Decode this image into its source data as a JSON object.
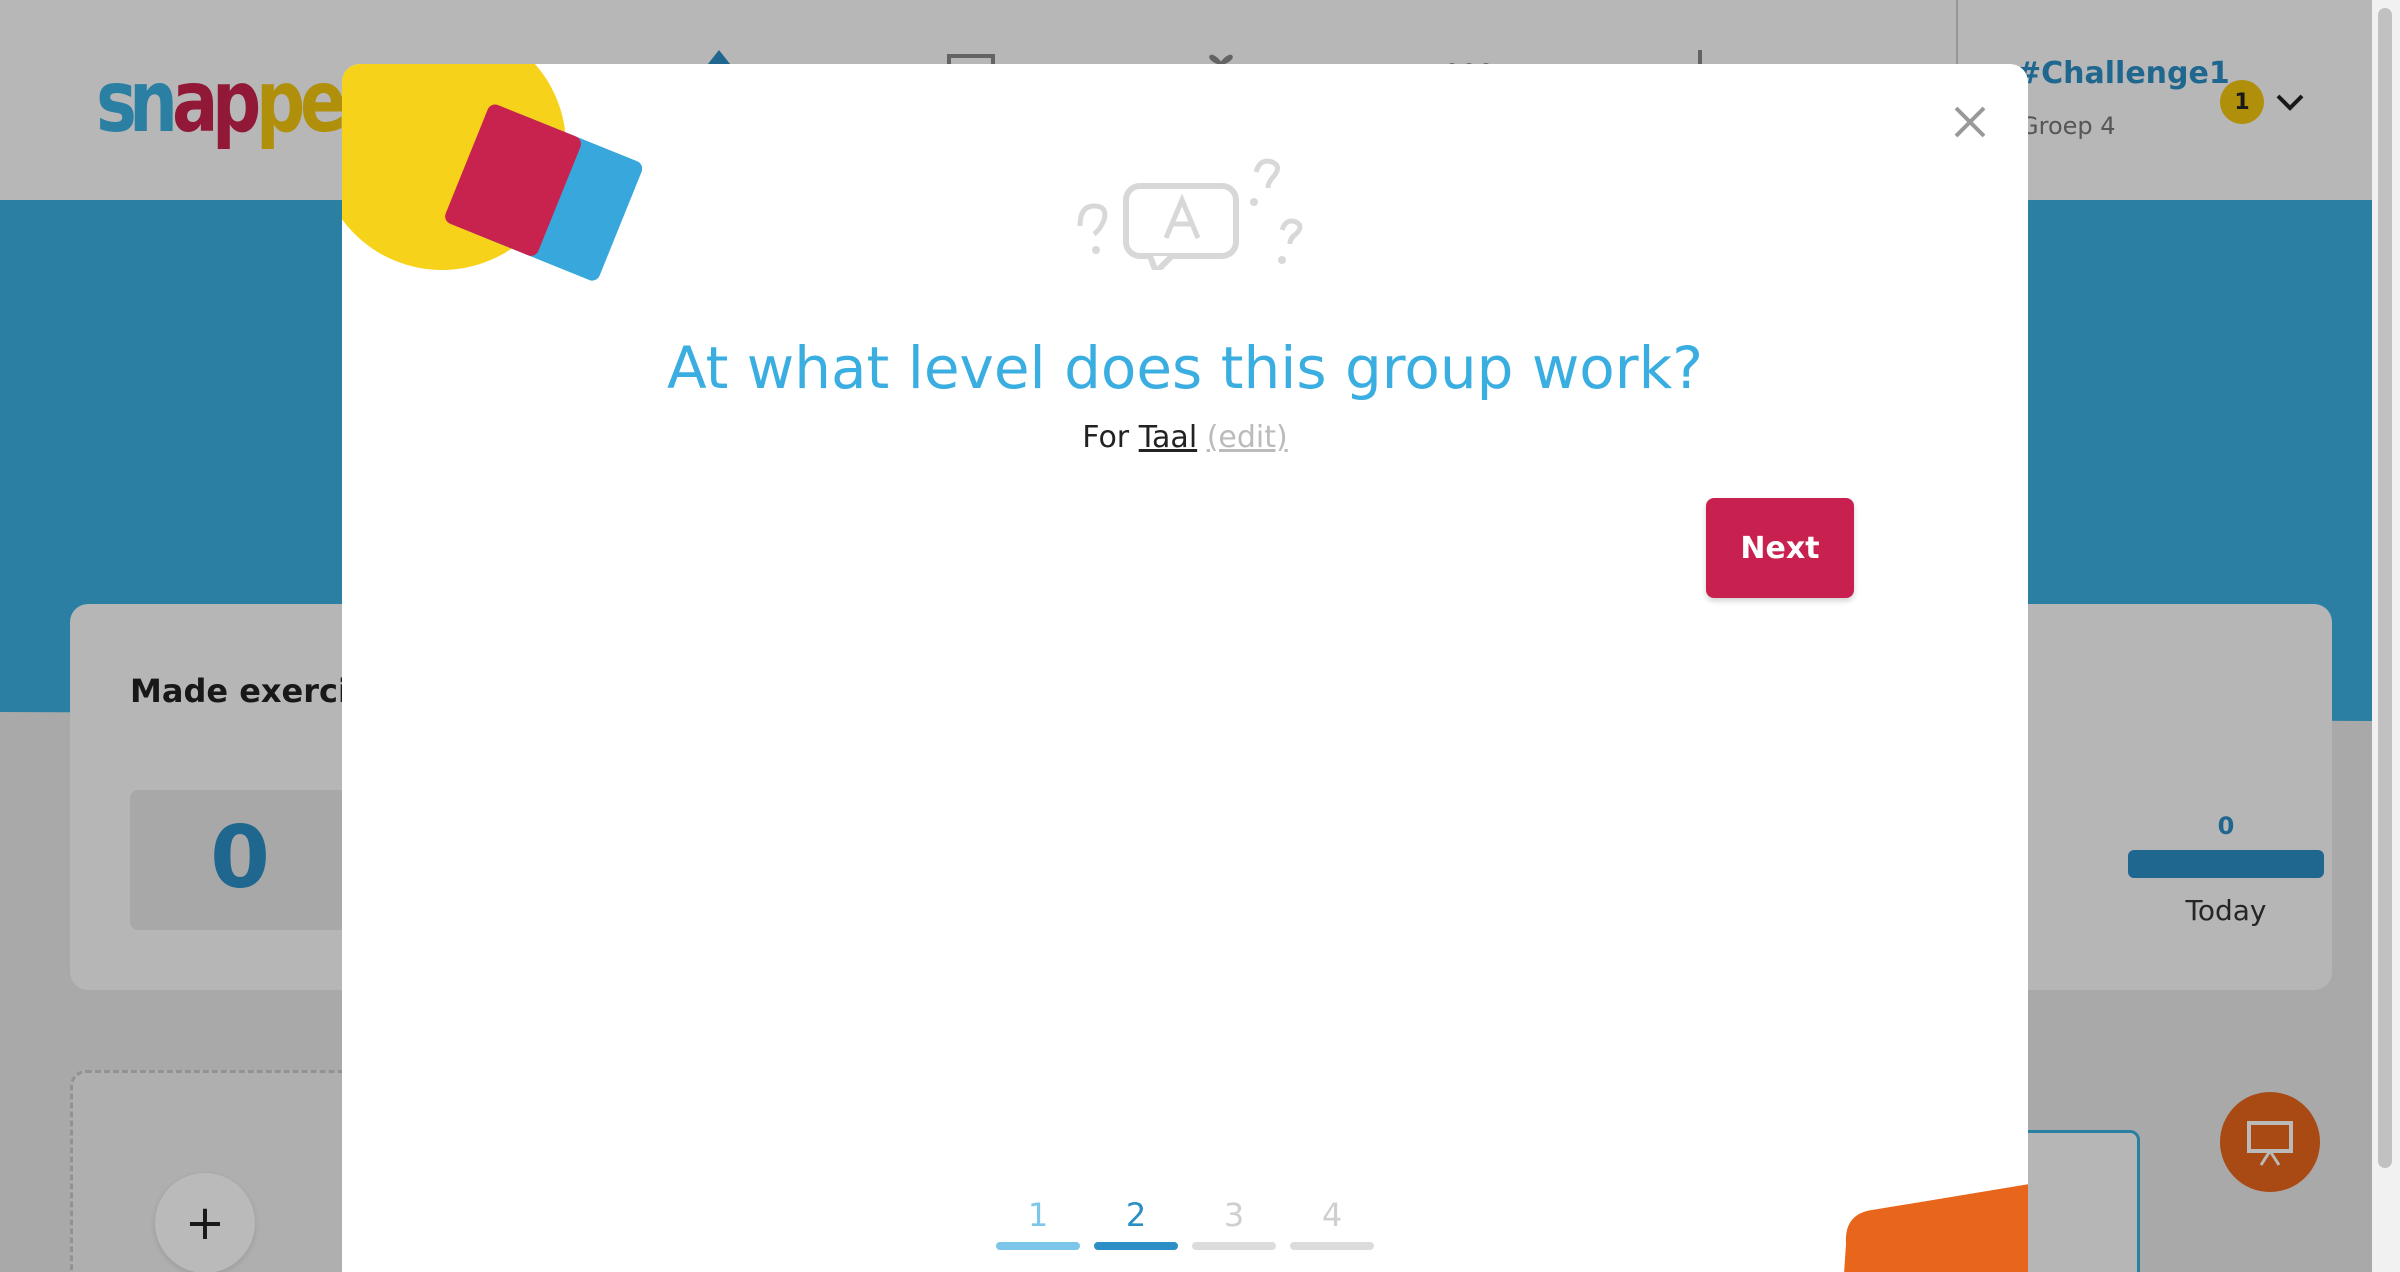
{
  "app": {
    "logo_text": "snappet",
    "user": {
      "name": "#Challenge1",
      "group": "Groep 4",
      "badge": "1"
    },
    "stats": {
      "title": "Made exercis",
      "value": "0",
      "today_value": "0",
      "today_label": "Today"
    },
    "add_label": "+"
  },
  "modal": {
    "title": "At what level does this group work?",
    "subtitle_prefix": "For",
    "subject": "Taal",
    "edit_label": "(edit)",
    "next_label": "Next",
    "close_label": "×",
    "illustration_letter": "A"
  },
  "steps": [
    {
      "label": "1",
      "state": "done"
    },
    {
      "label": "2",
      "state": "current"
    },
    {
      "label": "3",
      "state": "todo"
    },
    {
      "label": "4",
      "state": "todo"
    }
  ],
  "colors": {
    "accent_blue": "#3aaee0",
    "dark_blue": "#2b8ec4",
    "next_red": "#c82150",
    "deco_yellow": "#f6d21b",
    "deco_blue": "#38a8dc",
    "deco_red": "#c8224e",
    "present_orange": "#e8661c"
  },
  "icons": [
    "home-icon",
    "monitor-icon",
    "gift-icon",
    "dots-icon",
    "chart-icon",
    "chevron-down-icon",
    "close-icon",
    "presentation-icon",
    "speech-bubble-icon"
  ]
}
